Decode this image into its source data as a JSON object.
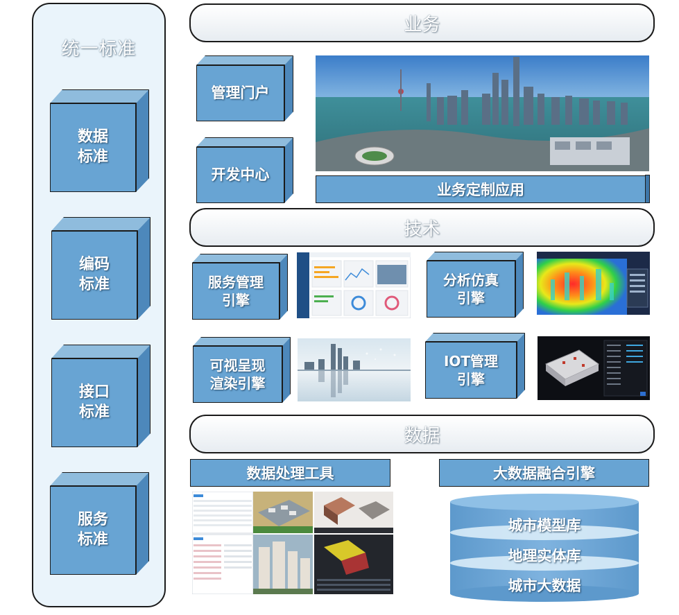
{
  "standards": {
    "title": "统一标准",
    "items": [
      {
        "line1": "数据",
        "line2": "标准"
      },
      {
        "line1": "编码",
        "line2": "标准"
      },
      {
        "line1": "接口",
        "line2": "标准"
      },
      {
        "line1": "服务",
        "line2": "标准"
      }
    ]
  },
  "business": {
    "title": "业务",
    "portal": "管理门户",
    "dev_center": "开发中心",
    "custom_app": "业务定制应用"
  },
  "technology": {
    "title": "技术",
    "service_engine": {
      "line1": "服务管理",
      "line2": "引擎"
    },
    "analysis_engine": {
      "line1": "分析仿真",
      "line2": "引擎"
    },
    "render_engine": {
      "line1": "可视呈现",
      "line2": "渲染引擎"
    },
    "iot_engine": {
      "line1": "IOT管理",
      "line2": "引擎"
    }
  },
  "data_layer": {
    "title": "数据",
    "tools": "数据处理工具",
    "fusion": "大数据融合引擎",
    "db": [
      "城市模型库",
      "地理实体库",
      "城市大数据"
    ]
  },
  "colors": {
    "box_front": "#68a4d3",
    "box_top": "#8fbcdd",
    "box_side": "#4d88bb",
    "panel_bg": "#eaf4fb",
    "outline": "#1a1a1a"
  }
}
